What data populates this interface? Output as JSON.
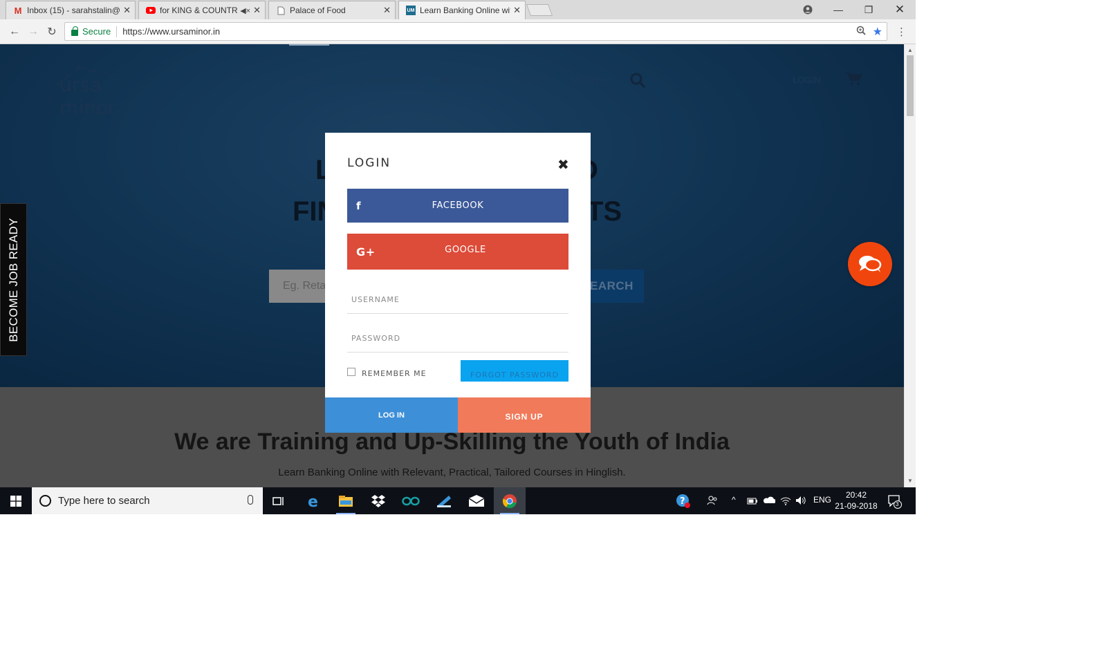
{
  "browser": {
    "tabs": [
      {
        "title": "Inbox (15) - sarahstalin@",
        "favicon": "gmail-icon",
        "color": "#d93025"
      },
      {
        "title": "for KING & COUNTRY",
        "favicon": "youtube-icon",
        "color": "#ff0000",
        "muted_icon": "speaker-muted-icon"
      },
      {
        "title": "Palace of Food",
        "favicon": "page-icon",
        "color": "#777777"
      },
      {
        "title": "Learn Banking Online wit",
        "favicon": "um-icon",
        "favicon_text": "UM",
        "color": "#1f6c8f"
      }
    ],
    "address": {
      "secure_label": "Secure",
      "url": "https://www.ursaminor.in"
    }
  },
  "site": {
    "logo_text": "ursa minor",
    "nav": [
      "HOME",
      "ALL COURSES",
      "ABOUT US",
      "BLOGS",
      "MORE+"
    ],
    "login_link": "LOGIN",
    "hero_line1_start": "L",
    "hero_line1_end": "D",
    "hero_line2_start": "FIN",
    "hero_line2_end": "TS",
    "search_placeholder": "Eg. Reta",
    "search_button": "EARCH",
    "side_tab": "BECOME JOB READY",
    "section_title": "We are Training and Up-Skilling the Youth of India",
    "section_subtitle": "Learn Banking Online with Relevant, Practical, Tailored Courses in Hinglish."
  },
  "modal": {
    "title": "LOGIN",
    "facebook_label": "FACEBOOK",
    "google_label": "GOOGLE",
    "google_icon_text": "G+",
    "facebook_icon_text": "f",
    "username_placeholder": "USERNAME",
    "password_placeholder": "PASSWORD",
    "remember_label": "REMEMBER ME",
    "forgot_label": "FORGOT PASSWORD",
    "login_label": "LOG IN",
    "signup_label": "SIGN UP"
  },
  "taskbar": {
    "search_placeholder": "Type here to search",
    "language": "ENG",
    "time": "20:42",
    "date": "21-09-2018",
    "notification_count": "3"
  },
  "colors": {
    "facebook": "#3b5998",
    "google": "#dd4b39",
    "login_button": "#3d8fd8",
    "signup_button": "#f07a5a",
    "chat_bubble": "#f0460e"
  }
}
